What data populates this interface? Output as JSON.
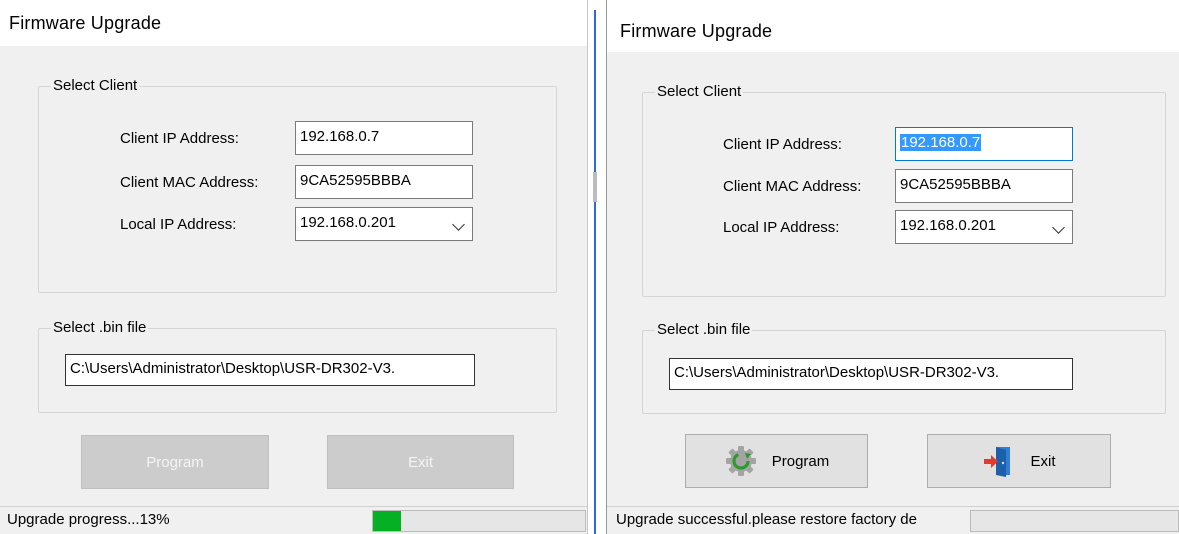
{
  "left": {
    "title": "Firmware Upgrade",
    "select_client_legend": "Select Client",
    "client_ip_label": "Client IP Address:",
    "client_ip_value": "192.168.0.7",
    "client_mac_label": "Client MAC Address:",
    "client_mac_value": "9CA52595BBBA",
    "local_ip_label": "Local IP Address:",
    "local_ip_value": "192.168.0.201",
    "bin_file_legend": "Select .bin file",
    "bin_file_path": "C:\\Users\\Administrator\\Desktop\\USR-DR302-V3.",
    "program_button": "Program",
    "exit_button": "Exit",
    "buttons_enabled": false,
    "status_text": "Upgrade progress...13%",
    "progress_fraction": 0.13
  },
  "right": {
    "title": "Firmware Upgrade",
    "select_client_legend": "Select Client",
    "client_ip_label": "Client IP Address:",
    "client_ip_value": "192.168.0.7",
    "client_mac_label": "Client MAC Address:",
    "client_mac_value": "9CA52595BBBA",
    "local_ip_label": "Local IP Address:",
    "local_ip_value": "192.168.0.201",
    "bin_file_legend": "Select .bin file",
    "bin_file_path": "C:\\Users\\Administrator\\Desktop\\USR-DR302-V3.",
    "program_button": "Program",
    "program_icon": "gear-refresh-icon",
    "exit_button": "Exit",
    "exit_icon": "exit-door-icon",
    "buttons_enabled": true,
    "status_text": "Upgrade successful.please restore factory de",
    "progress_fraction": 0
  },
  "colors": {
    "progress_fill": "#06b025",
    "selection_highlight": "#3399ff",
    "focus_border": "#0078d7"
  }
}
